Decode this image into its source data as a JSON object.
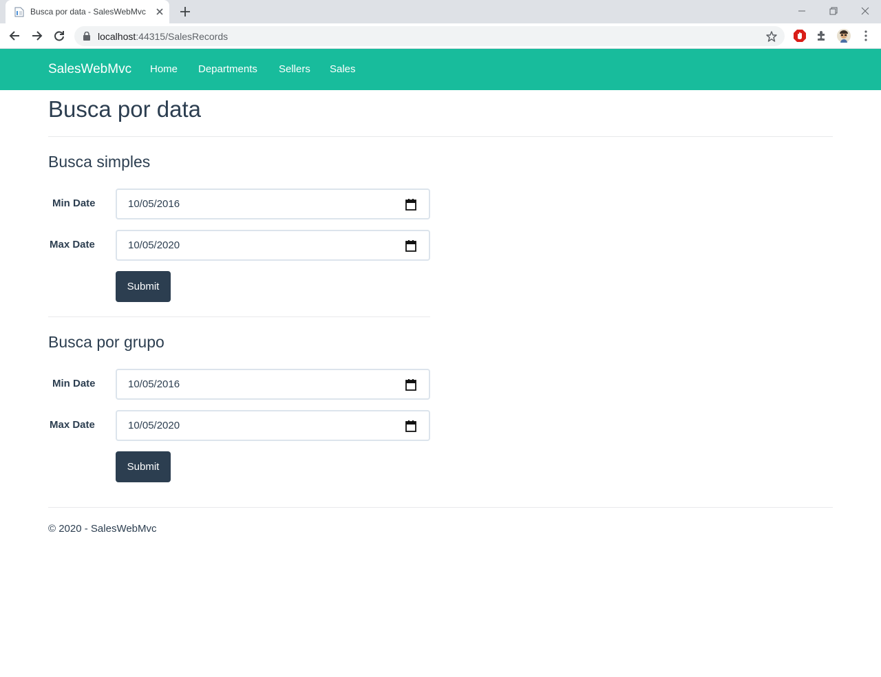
{
  "browser": {
    "tab_title": "Busca por data - SalesWebMvc",
    "url_host": "localhost",
    "url_rest": ":44315/SalesRecords"
  },
  "navbar": {
    "brand": "SalesWebMvc",
    "links": [
      "Home",
      "Departments",
      "Sellers",
      "Sales"
    ],
    "color": "#18bc9c"
  },
  "page": {
    "title": "Busca por data"
  },
  "simple_search": {
    "title": "Busca simples",
    "min_label": "Min Date",
    "min_value": "10/05/2016",
    "max_label": "Max Date",
    "max_value": "10/05/2020",
    "submit": "Submit"
  },
  "group_search": {
    "title": "Busca por grupo",
    "min_label": "Min Date",
    "min_value": "10/05/2016",
    "max_label": "Max Date",
    "max_value": "10/05/2020",
    "submit": "Submit"
  },
  "footer": {
    "text": "© 2020 - SalesWebMvc"
  },
  "colors": {
    "primary": "#2c3e50",
    "success": "#18bc9c"
  }
}
